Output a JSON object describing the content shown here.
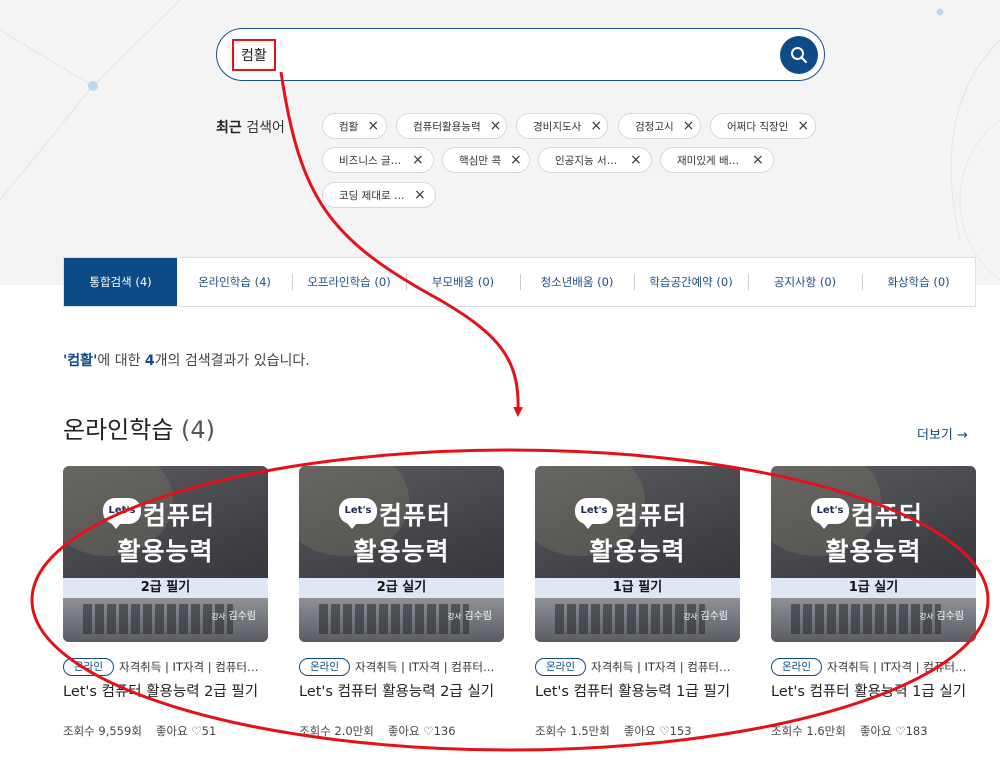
{
  "search": {
    "query": "컴활"
  },
  "recent": {
    "label_bold": "최근",
    "label_rest": " 검색어",
    "chips": [
      "컴활",
      "컴퓨터활용능력",
      "경비지도사",
      "검정고시",
      "어쩌다 직장인",
      "비즈니스 글…",
      "핵심만 콕",
      "인공지능 서…",
      "재미있게 배…",
      "코딩 제대로 …"
    ]
  },
  "tabs": [
    "통합검색 (4)",
    "온라인학습 (4)",
    "오프라인학습 (0)",
    "부모배움 (0)",
    "청소년배움 (0)",
    "학습공간예약 (0)",
    "공지사항 (0)",
    "화상학습 (0)"
  ],
  "summary": {
    "quote_open": "'",
    "term": "컴활",
    "quote_close": "'",
    "mid": "에 대한 ",
    "count": "4",
    "tail": "개의 검색결과가 있습니다."
  },
  "section": {
    "title": "온라인학습",
    "count": "(4)",
    "more": "더보기 →"
  },
  "cards": [
    {
      "badge": "Let's",
      "line1": "컴퓨터",
      "line2": "활용능력",
      "level": "2급 필기",
      "teacher_prefix": "강사",
      "teacher": "김수림",
      "tag": "온라인",
      "category": "자격취득 | IT자격 | 컴퓨터활용능력",
      "title": "Let's 컴퓨터 활용능력 2급 필기",
      "views": "조회수 9,559회",
      "likes_label": "좋아요",
      "likes": "♡51"
    },
    {
      "badge": "Let's",
      "line1": "컴퓨터",
      "line2": "활용능력",
      "level": "2급 실기",
      "teacher_prefix": "강사",
      "teacher": "김수림",
      "tag": "온라인",
      "category": "자격취득 | IT자격 | 컴퓨터활용능력",
      "title": "Let's 컴퓨터 활용능력 2급 실기",
      "views": "조회수 2.0만회",
      "likes_label": "좋아요",
      "likes": "♡136"
    },
    {
      "badge": "Let's",
      "line1": "컴퓨터",
      "line2": "활용능력",
      "level": "1급 필기",
      "teacher_prefix": "강사",
      "teacher": "김수림",
      "tag": "온라인",
      "category": "자격취득 | IT자격 | 컴퓨터활용능력",
      "title": "Let's 컴퓨터 활용능력 1급 필기",
      "views": "조회수 1.5만회",
      "likes_label": "좋아요",
      "likes": "♡153"
    },
    {
      "badge": "Let's",
      "line1": "컴퓨터",
      "line2": "활용능력",
      "level": "1급 실기",
      "teacher_prefix": "강사",
      "teacher": "김수림",
      "tag": "온라인",
      "category": "자격취득 | IT자격 | 컴퓨터활용능력",
      "title": "Let's 컴퓨터 활용능력 1급 실기",
      "views": "조회수 1.6만회",
      "likes_label": "좋아요",
      "likes": "♡183"
    }
  ],
  "colors": {
    "brand": "#0e4b86",
    "annotation": "#e3121a",
    "top_bg": "#f4f4f5"
  }
}
